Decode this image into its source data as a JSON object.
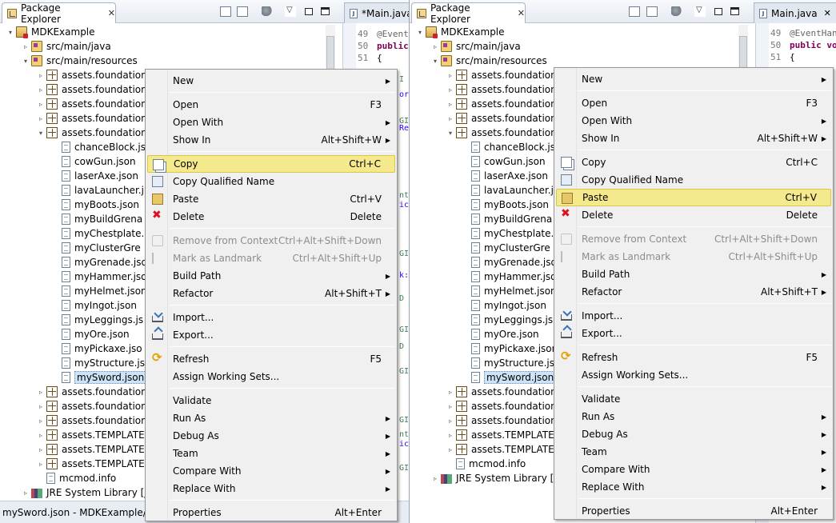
{
  "left": {
    "view_tab": "Package Explorer",
    "editor_tab": "*Main.java",
    "code_lines": [
      {
        "num": "49",
        "text": "@Event"
      },
      {
        "num": "50",
        "text": "public"
      },
      {
        "num": "51",
        "text": "{"
      }
    ],
    "code_fragments": [
      "I",
      "or",
      "GI",
      "Re",
      "nt",
      "ic",
      "GI",
      "k:",
      "D",
      "GI",
      "D",
      "GI",
      "GI",
      "nt",
      "ic",
      "GI"
    ],
    "tree": [
      {
        "label": "MDKExample",
        "icon": "project-icon",
        "arrow": "▾"
      },
      {
        "label": "src/main/java",
        "icon": "source-folder-icon",
        "arrow": "▹"
      },
      {
        "label": "src/main/resources",
        "icon": "source-folder-icon",
        "arrow": "▾"
      },
      {
        "label": "assets.foundations",
        "icon": "package-icon",
        "arrow": "▹"
      },
      {
        "label": "assets.foundations",
        "icon": "package-icon",
        "arrow": "▹"
      },
      {
        "label": "assets.foundations",
        "icon": "package-icon",
        "arrow": "▹"
      },
      {
        "label": "assets.foundations",
        "icon": "package-icon",
        "arrow": "▹"
      },
      {
        "label": "assets.foundations",
        "icon": "package-icon",
        "arrow": "▾"
      },
      {
        "label": "chanceBlock.js",
        "icon": "file-icon",
        "arrow": ""
      },
      {
        "label": "cowGun.json",
        "icon": "file-icon",
        "arrow": ""
      },
      {
        "label": "laserAxe.json",
        "icon": "file-icon",
        "arrow": ""
      },
      {
        "label": "lavaLauncher.j",
        "icon": "file-icon",
        "arrow": ""
      },
      {
        "label": "myBoots.json",
        "icon": "file-icon",
        "arrow": ""
      },
      {
        "label": "myBuildGrena",
        "icon": "file-icon",
        "arrow": ""
      },
      {
        "label": "myChestplate.",
        "icon": "file-icon",
        "arrow": ""
      },
      {
        "label": "myClusterGre",
        "icon": "file-icon",
        "arrow": ""
      },
      {
        "label": "myGrenade.jso",
        "icon": "file-icon",
        "arrow": ""
      },
      {
        "label": "myHammer.jso",
        "icon": "file-icon",
        "arrow": ""
      },
      {
        "label": "myHelmet.json",
        "icon": "file-icon",
        "arrow": ""
      },
      {
        "label": "myIngot.json",
        "icon": "file-icon",
        "arrow": ""
      },
      {
        "label": "myLeggings.js",
        "icon": "file-icon",
        "arrow": ""
      },
      {
        "label": "myOre.json",
        "icon": "file-icon",
        "arrow": ""
      },
      {
        "label": "myPickaxe.jso",
        "icon": "file-icon",
        "arrow": ""
      },
      {
        "label": "myStructure.js",
        "icon": "file-icon",
        "arrow": ""
      },
      {
        "label": "mySword.json",
        "icon": "file-icon",
        "arrow": "",
        "selected": true
      },
      {
        "label": "assets.foundations",
        "icon": "package-icon",
        "arrow": "▹"
      },
      {
        "label": "assets.foundations",
        "icon": "package-icon",
        "arrow": "▹"
      },
      {
        "label": "assets.foundations",
        "icon": "package-icon",
        "arrow": "▹"
      },
      {
        "label": "assets.TEMPLATES",
        "icon": "package-icon",
        "arrow": "▹"
      },
      {
        "label": "assets.TEMPLATES",
        "icon": "package-icon",
        "arrow": "▹"
      },
      {
        "label": "assets.TEMPLATES",
        "icon": "package-icon",
        "arrow": "▹"
      },
      {
        "label": "mcmod.info",
        "icon": "file-icon",
        "arrow": ""
      },
      {
        "label": "JRE System Library [jre",
        "icon": "library-icon",
        "arrow": "▹"
      }
    ],
    "status": "mySword.json - MDKExample/src/",
    "highlighted": "Copy"
  },
  "right": {
    "view_tab": "Package Explorer",
    "editor_tab": "Main.java",
    "code_lines": [
      {
        "num": "49",
        "text": "@EventHan"
      },
      {
        "num": "50",
        "text": "public vo"
      },
      {
        "num": "51",
        "text": "{"
      }
    ],
    "tree": [
      {
        "label": "MDKExample",
        "icon": "project-icon",
        "arrow": "▾"
      },
      {
        "label": "src/main/java",
        "icon": "source-folder-icon",
        "arrow": "▹"
      },
      {
        "label": "src/main/resources",
        "icon": "source-folder-icon",
        "arrow": "▾"
      },
      {
        "label": "assets.foundations",
        "icon": "package-icon",
        "arrow": "▹"
      },
      {
        "label": "assets.foundations",
        "icon": "package-icon",
        "arrow": "▹"
      },
      {
        "label": "assets.foundations",
        "icon": "package-icon",
        "arrow": "▹"
      },
      {
        "label": "assets.foundations",
        "icon": "package-icon",
        "arrow": "▹"
      },
      {
        "label": "assets.foundations",
        "icon": "package-icon",
        "arrow": "▾"
      },
      {
        "label": "chanceBlock.js",
        "icon": "file-icon",
        "arrow": ""
      },
      {
        "label": "cowGun.json",
        "icon": "file-icon",
        "arrow": ""
      },
      {
        "label": "laserAxe.json",
        "icon": "file-icon",
        "arrow": ""
      },
      {
        "label": "lavaLauncher.j",
        "icon": "file-icon",
        "arrow": ""
      },
      {
        "label": "myBoots.json",
        "icon": "file-icon",
        "arrow": ""
      },
      {
        "label": "myBuildGrena",
        "icon": "file-icon",
        "arrow": ""
      },
      {
        "label": "myChestplate.",
        "icon": "file-icon",
        "arrow": ""
      },
      {
        "label": "myClusterGre",
        "icon": "file-icon",
        "arrow": ""
      },
      {
        "label": "myGrenade.jso",
        "icon": "file-icon",
        "arrow": ""
      },
      {
        "label": "myHammer.jso",
        "icon": "file-icon",
        "arrow": ""
      },
      {
        "label": "myHelmet.json",
        "icon": "file-icon",
        "arrow": ""
      },
      {
        "label": "myIngot.json",
        "icon": "file-icon",
        "arrow": ""
      },
      {
        "label": "myLeggings.js",
        "icon": "file-icon",
        "arrow": ""
      },
      {
        "label": "myOre.json",
        "icon": "file-icon",
        "arrow": ""
      },
      {
        "label": "myPickaxe.json",
        "icon": "file-icon",
        "arrow": ""
      },
      {
        "label": "myStructure.js",
        "icon": "file-icon",
        "arrow": ""
      },
      {
        "label": "mySword.json",
        "icon": "file-icon",
        "arrow": "",
        "selected": true
      },
      {
        "label": "assets.foundations",
        "icon": "package-icon",
        "arrow": "▹"
      },
      {
        "label": "assets.foundations",
        "icon": "package-icon",
        "arrow": "▹"
      },
      {
        "label": "assets.foundations",
        "icon": "package-icon",
        "arrow": "▹"
      },
      {
        "label": "assets.TEMPLATES",
        "icon": "package-icon",
        "arrow": "▹"
      },
      {
        "label": "assets.TEMPLATES",
        "icon": "package-icon",
        "arrow": "▹"
      },
      {
        "label": "mcmod.info",
        "icon": "file-icon",
        "arrow": ""
      },
      {
        "label": "JRE System Library [jre",
        "icon": "library-icon",
        "arrow": "▹"
      }
    ],
    "highlighted": "Paste"
  },
  "menu": [
    {
      "label": "New",
      "submenu": true
    },
    {
      "sep": true
    },
    {
      "label": "Open",
      "accel": "F3"
    },
    {
      "label": "Open With",
      "submenu": true
    },
    {
      "label": "Show In",
      "accel": "Alt+Shift+W",
      "submenu": true
    },
    {
      "sep": true
    },
    {
      "label": "Copy",
      "accel": "Ctrl+C",
      "icon": "copy-icon"
    },
    {
      "label": "Copy Qualified Name",
      "icon": "copy-qualified-name-icon"
    },
    {
      "label": "Paste",
      "accel": "Ctrl+V",
      "icon": "paste-icon"
    },
    {
      "label": "Delete",
      "accel": "Delete",
      "icon": "delete-icon"
    },
    {
      "sep": true
    },
    {
      "label": "Remove from Context",
      "accel": "Ctrl+Alt+Shift+Down",
      "disabled": true,
      "icon": "remove-context-icon"
    },
    {
      "label": "Mark as Landmark",
      "accel": "Ctrl+Alt+Shift+Up",
      "disabled": true,
      "icon": "landmark-icon"
    },
    {
      "label": "Build Path",
      "submenu": true
    },
    {
      "label": "Refactor",
      "accel": "Alt+Shift+T",
      "submenu": true
    },
    {
      "sep": true
    },
    {
      "label": "Import...",
      "icon": "import-icon"
    },
    {
      "label": "Export...",
      "icon": "export-icon"
    },
    {
      "sep": true
    },
    {
      "label": "Refresh",
      "accel": "F5",
      "icon": "refresh-icon"
    },
    {
      "label": "Assign Working Sets..."
    },
    {
      "sep": true
    },
    {
      "label": "Validate"
    },
    {
      "label": "Run As",
      "submenu": true
    },
    {
      "label": "Debug As",
      "submenu": true
    },
    {
      "label": "Team",
      "submenu": true
    },
    {
      "label": "Compare With",
      "submenu": true
    },
    {
      "label": "Replace With",
      "submenu": true
    },
    {
      "sep": true
    },
    {
      "label": "Properties",
      "accel": "Alt+Enter"
    }
  ],
  "colors": {
    "highlight": "#f5e98d",
    "selection": "#cfe3f7"
  }
}
